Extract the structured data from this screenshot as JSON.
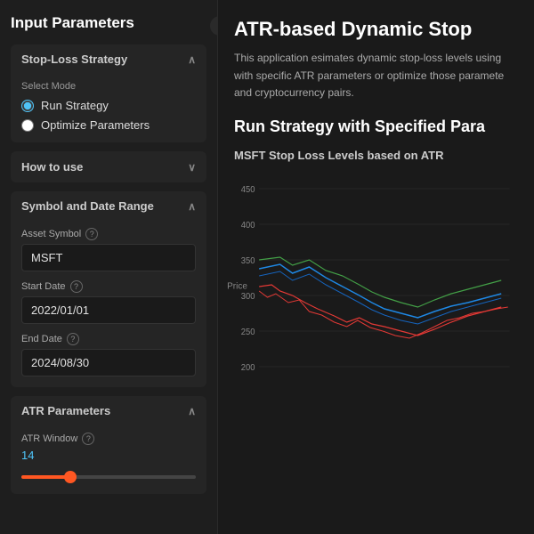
{
  "sidebar": {
    "title": "Input Parameters",
    "toggle_icon": "‹",
    "sections": {
      "stop_loss": {
        "label": "Stop-Loss Strategy",
        "chevron": "∧",
        "select_mode_label": "Select Mode",
        "options": [
          {
            "id": "run",
            "label": "Run Strategy",
            "checked": true
          },
          {
            "id": "optimize",
            "label": "Optimize Parameters",
            "checked": false
          }
        ]
      },
      "how_to_use": {
        "label": "How to use",
        "chevron": "∨"
      },
      "symbol_date": {
        "label": "Symbol and Date Range",
        "chevron": "∧",
        "fields": {
          "asset_symbol": {
            "label": "Asset Symbol",
            "value": "MSFT"
          },
          "start_date": {
            "label": "Start Date",
            "value": "2022/01/01"
          },
          "end_date": {
            "label": "End Date",
            "value": "2024/08/30"
          }
        }
      },
      "atr_params": {
        "label": "ATR Parameters",
        "chevron": "∧",
        "atr_window_label": "ATR Window",
        "atr_value": "14",
        "slider_min": 1,
        "slider_max": 50,
        "slider_current": 14
      }
    }
  },
  "main": {
    "title": "ATR-based Dynamic Stop",
    "description": "This application esimates dynamic stop-loss levels using with specific ATR parameters or optimize those paramete and cryptocurrency pairs.",
    "run_section_title": "Run Strategy with Specified Para",
    "chart_title": "MSFT Stop Loss Levels based on ATR",
    "y_axis_label": "Price",
    "y_axis_ticks": [
      "450",
      "400",
      "350",
      "300",
      "250",
      "200"
    ],
    "chart": {
      "accent_color": "#ff5722",
      "colors": {
        "red": "#e53935",
        "green": "#43a047",
        "blue": "#1e88e5"
      }
    }
  }
}
